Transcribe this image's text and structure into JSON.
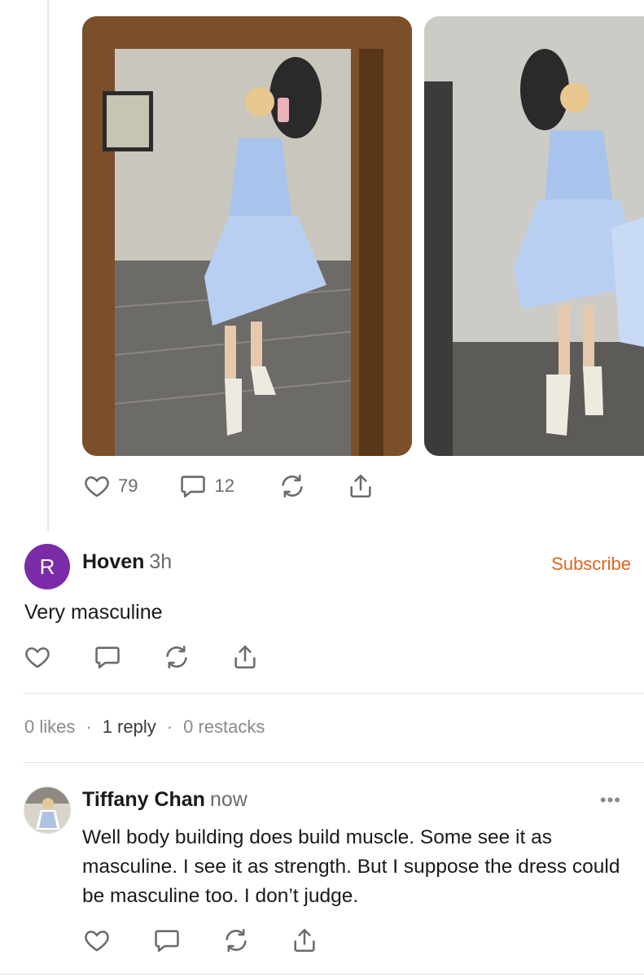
{
  "post": {
    "likes": "79",
    "comments": "12"
  },
  "comment": {
    "avatar_letter": "R",
    "avatar_color": "#7b2ba8",
    "author": "Hoven",
    "time": "3h",
    "subscribe_label": "Subscribe",
    "text": "Very masculine"
  },
  "stats": {
    "likes": "0 likes",
    "replies": "1 reply",
    "restacks": "0 restacks",
    "separator": "·"
  },
  "reply": {
    "author": "Tiffany Chan",
    "time": "now",
    "more_label": "•••",
    "text": "Well body building does build muscle. Some see it as masculine. I see it as strength. But I suppose the dress could be masculine too. I don’t judge."
  },
  "colors": {
    "accent": "#e0641f",
    "muted": "#6b6b6b",
    "dress": "#a9c4ec"
  },
  "icons": [
    "heart-icon",
    "comment-icon",
    "restack-icon",
    "share-icon",
    "more-icon"
  ]
}
